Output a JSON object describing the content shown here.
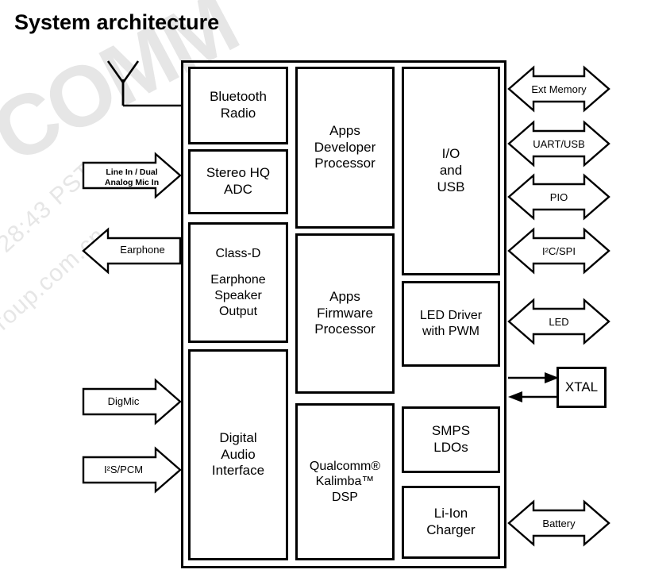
{
  "page": {
    "title": "System architecture",
    "colors": {
      "stroke": "#000000",
      "background": "#ffffff",
      "watermark": "#e6e6e6"
    }
  },
  "watermark": {
    "lines": [
      "COMM",
      "28:43 PST",
      "roup.com.cn"
    ]
  },
  "antenna": {
    "name": "antenna-symbol",
    "connects_to": "Bluetooth Radio"
  },
  "chip": {
    "label": "system-on-chip-outline"
  },
  "blocks": {
    "left_column": [
      {
        "id": "bluetooth-radio",
        "lines": [
          "Bluetooth",
          "Radio"
        ]
      },
      {
        "id": "stereo-hq-adc",
        "lines": [
          "Stereo HQ",
          "ADC"
        ]
      },
      {
        "id": "class-d-amp",
        "lines": [
          "Class-D",
          "",
          "Earphone",
          "Speaker",
          "Output"
        ]
      },
      {
        "id": "digital-audio-interface",
        "lines": [
          "Digital",
          "Audio",
          "Interface"
        ]
      }
    ],
    "middle_column": [
      {
        "id": "apps-developer-processor",
        "lines": [
          "Apps",
          "Developer",
          "Processor"
        ]
      },
      {
        "id": "apps-firmware-processor",
        "lines": [
          "Apps",
          "Firmware",
          "Processor"
        ]
      },
      {
        "id": "kalimba-dsp",
        "lines": [
          "Qualcomm®",
          "Kalimba™",
          "DSP"
        ]
      }
    ],
    "right_column": [
      {
        "id": "io-and-usb",
        "lines": [
          "I/O",
          "and",
          "USB"
        ]
      },
      {
        "id": "led-driver",
        "lines": [
          "LED Driver",
          "with PWM"
        ]
      },
      {
        "id": "smps-ldos",
        "lines": [
          "SMPS",
          "LDOs"
        ]
      },
      {
        "id": "li-ion-charger",
        "lines": [
          "Li-Ion",
          "Charger"
        ]
      }
    ]
  },
  "external": {
    "xtal": {
      "label": "XTAL",
      "direction": "bidirectional-pair"
    }
  },
  "left_ports": [
    {
      "id": "line-in-dual-analog-mic-in",
      "label_line1": "Line In / Dual",
      "label_line2": "Analog Mic In",
      "direction": "in"
    },
    {
      "id": "earphone",
      "label_line1": "Earphone",
      "label_line2": "",
      "direction": "out"
    },
    {
      "id": "digmic",
      "label_line1": "DigMic",
      "label_line2": "",
      "direction": "in"
    },
    {
      "id": "i2s-pcm",
      "label_line1": "I²S/PCM",
      "label_line2": "",
      "direction": "in"
    }
  ],
  "right_ports": [
    {
      "id": "ext-memory",
      "label": "Ext Memory",
      "direction": "bidirectional"
    },
    {
      "id": "uart-usb",
      "label": "UART/USB",
      "direction": "bidirectional"
    },
    {
      "id": "pio",
      "label": "PIO",
      "direction": "bidirectional"
    },
    {
      "id": "i2c-spi",
      "label": "I²C/SPI",
      "direction": "bidirectional"
    },
    {
      "id": "led",
      "label": "LED",
      "direction": "bidirectional"
    },
    {
      "id": "battery",
      "label": "Battery",
      "direction": "bidirectional"
    }
  ]
}
